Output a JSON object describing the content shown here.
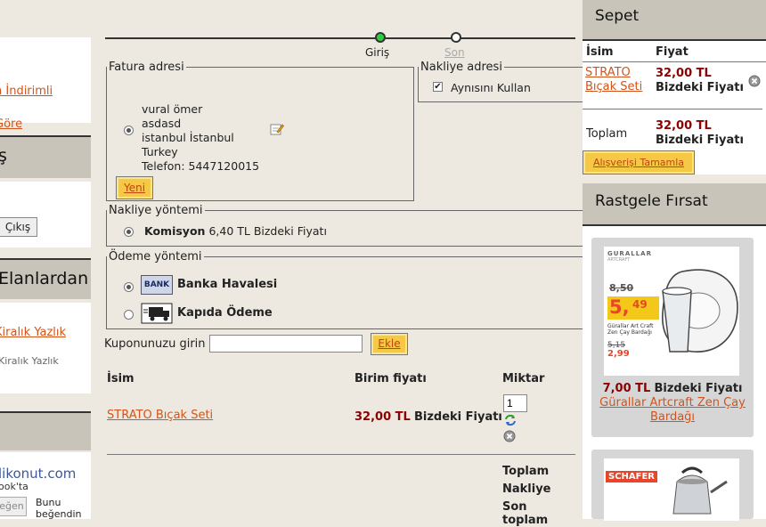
{
  "left": {
    "links1": [
      "n İndirimli",
      "Göre"
    ],
    "section2_title": "ş",
    "logout": "Çıkış",
    "section3_title": "Elanlardan",
    "links3": [
      "Kiralık Yazlık",
      "Kiralık Yazlık"
    ],
    "site": "likonut.com",
    "fb_text": "ook'ta",
    "fb_btn": "eğen",
    "fb_like": [
      "Bunu",
      "beğendin"
    ]
  },
  "progress": {
    "step1": "Giriş",
    "step2": "Son"
  },
  "billing": {
    "legend": "Fatura adresi",
    "lines": [
      "vural ömer",
      "asdasd",
      "istanbul İstanbul",
      "Turkey",
      "Telefon:  5447120015"
    ],
    "new_btn": "Yeni"
  },
  "shipping_addr": {
    "legend": "Nakliye adresi",
    "same": "Aynısını Kullan"
  },
  "shipping_method": {
    "legend": "Nakliye yöntemi",
    "name": "Komisyon",
    "price": "6,40 TL Bizdeki Fiyatı"
  },
  "payment": {
    "legend": "Ödeme yöntemi",
    "bank_icon": "BANK",
    "bank": "Banka Havalesi",
    "cod": "Kapıda Ödeme"
  },
  "coupon": {
    "label": "Kuponunuzu girin",
    "value": "",
    "btn": "Ekle"
  },
  "cart_table": {
    "headers": [
      "İsim",
      "Birim fiyatı",
      "Miktar"
    ],
    "row": {
      "name": "STRATO Bıçak Seti",
      "price": "32,00 TL",
      "price_suffix": "Bizdeki Fiyatı",
      "qty": "1"
    },
    "totals": [
      "Toplam",
      "Nakliye",
      "Son toplam"
    ]
  },
  "sepet": {
    "title": "Sepet",
    "col_name": "İsim",
    "col_price": "Fiyat",
    "item_name_1": "STRATO",
    "item_name_2": "Bıçak Seti",
    "item_price": "32,00 TL",
    "item_suffix": "Bizdeki Fiyatı",
    "total_label": "Toplam",
    "total_price": "32,00 TL",
    "total_suffix": "Bizdeki Fiyatı",
    "checkout_btn": "Alışverişi Tamamla"
  },
  "deal": {
    "title": "Rastgele Fırsat",
    "brand": "GURALLAR",
    "brand_sub": "ARTCRAFT",
    "old1": "8,50",
    "new_int": "5,",
    "new_dec": "49",
    "old2": "5,15",
    "new2": "2,99",
    "img_text": "Gürallar Art Craft Zen Çay Bardağı",
    "price": "7,00 TL",
    "price_suffix": "Bizdeki Fiyatı",
    "name": "Gürallar Artcraft Zen Çay Bardağı",
    "brand2": "SCHAFER"
  },
  "colors": {
    "accent": "#d2541a",
    "price": "#8b0000",
    "button": "#f5c846",
    "progress_active": "#2ecc40"
  }
}
